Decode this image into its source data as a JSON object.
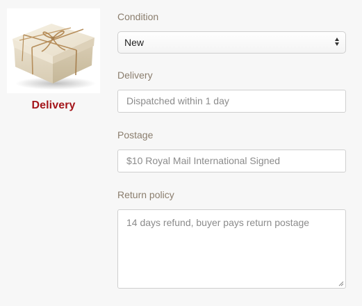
{
  "sidebar": {
    "image_name": "gift-box-icon",
    "label": "Delivery"
  },
  "form": {
    "condition": {
      "label": "Condition",
      "selected": "New"
    },
    "delivery": {
      "label": "Delivery",
      "placeholder": "Dispatched within 1 day"
    },
    "postage": {
      "label": "Postage",
      "placeholder": "$10 Royal Mail International Signed"
    },
    "return_policy": {
      "label": "Return policy",
      "placeholder": "14 days refund, buyer pays return postage"
    }
  },
  "colors": {
    "accent_red": "#a4151a",
    "label_brown": "#8a7d6d",
    "border": "#cfcfcf",
    "background": "#f7f7f7"
  }
}
